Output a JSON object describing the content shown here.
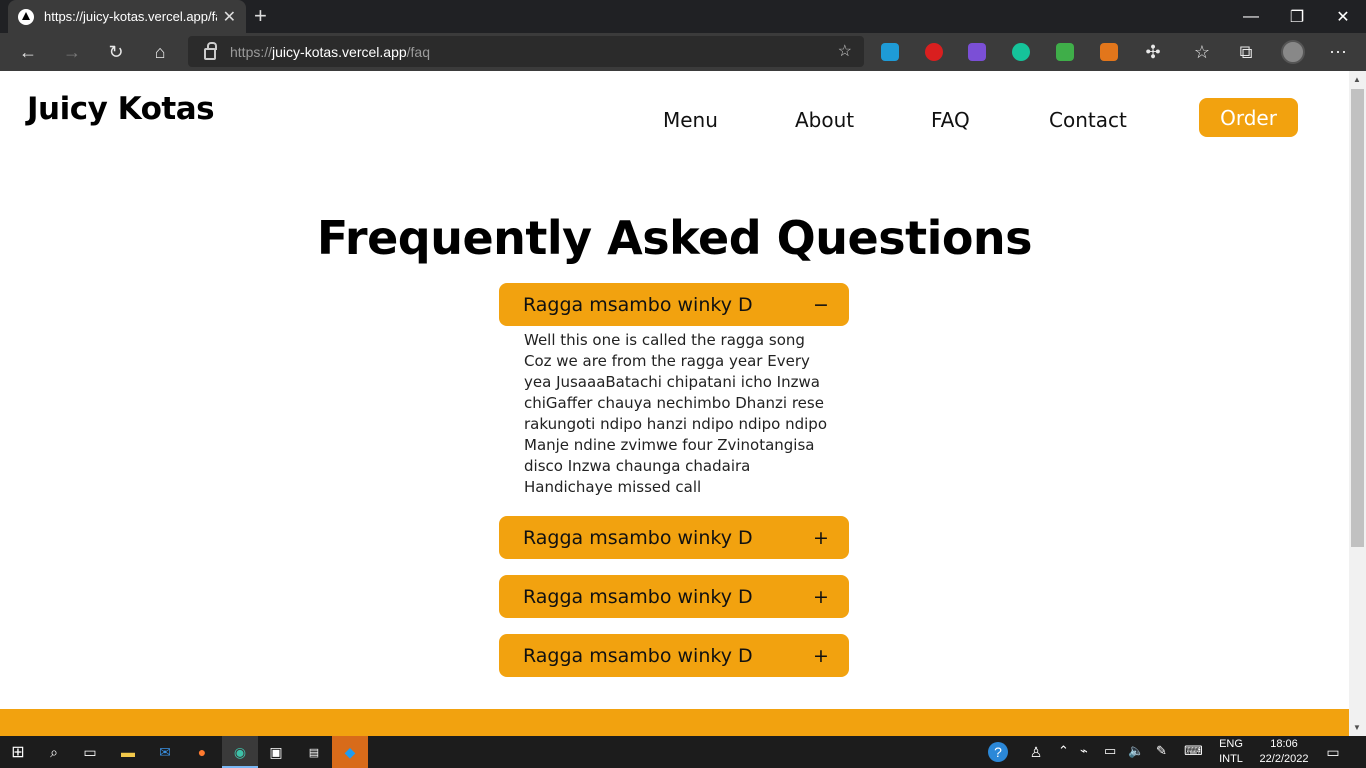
{
  "browser": {
    "tab_title": "https://juicy-kotas.vercel.app/faq",
    "url_scheme": "https://",
    "url_host": "juicy-kotas.vercel.app",
    "url_path": "/faq"
  },
  "site": {
    "brand": "Juicy Kotas",
    "nav": [
      "Menu",
      "About",
      "FAQ",
      "Contact"
    ],
    "order_label": "Order"
  },
  "faq": {
    "title": "Frequently Asked Questions",
    "items": [
      {
        "question": "Ragga msambo winky D",
        "toggle": "−",
        "expanded": true,
        "answer": "Well this one is called the ragga song Coz we are from the ragga year Every yea JusaaaBatachi chipatani icho Inzwa chiGaffer chauya nechimbo Dhanzi rese rakungoti ndipo hanzi ndipo ndipo ndipo Manje ndine zvimwe four Zvinotangisa disco Inzwa chaunga chadaira Handichaye missed call"
      },
      {
        "question": "Ragga msambo winky D",
        "toggle": "+",
        "expanded": false
      },
      {
        "question": "Ragga msambo winky D",
        "toggle": "+",
        "expanded": false
      },
      {
        "question": "Ragga msambo winky D",
        "toggle": "+",
        "expanded": false
      }
    ]
  },
  "colors": {
    "accent": "#f2a20f"
  },
  "taskbar": {
    "lang_top": "ENG",
    "lang_bottom": "INTL",
    "time": "18:06",
    "date": "22/2/2022"
  }
}
